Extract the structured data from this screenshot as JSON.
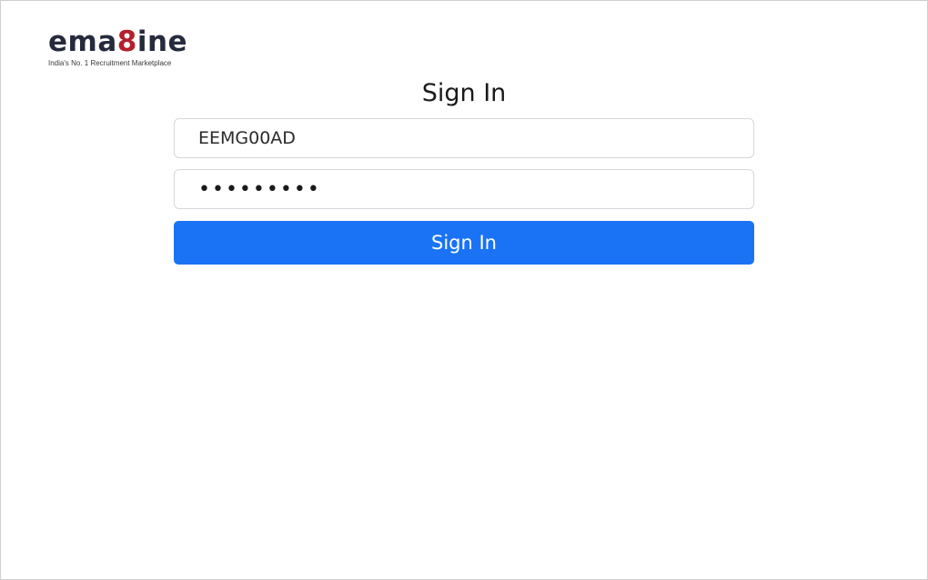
{
  "logo": {
    "word_prefix": "ema",
    "word_eight": "8",
    "word_suffix": "ine",
    "tagline": "India's No. 1 Recruitment Marketplace"
  },
  "form": {
    "title": "Sign In",
    "username_value": "EEMG00AD",
    "password_masked": "•••••••••",
    "submit_label": "Sign In"
  },
  "colors": {
    "brand_dark": "#262a3d",
    "brand_accent": "#b3202c",
    "button": "#1a73f5",
    "input_border": "#d5d8dc"
  }
}
